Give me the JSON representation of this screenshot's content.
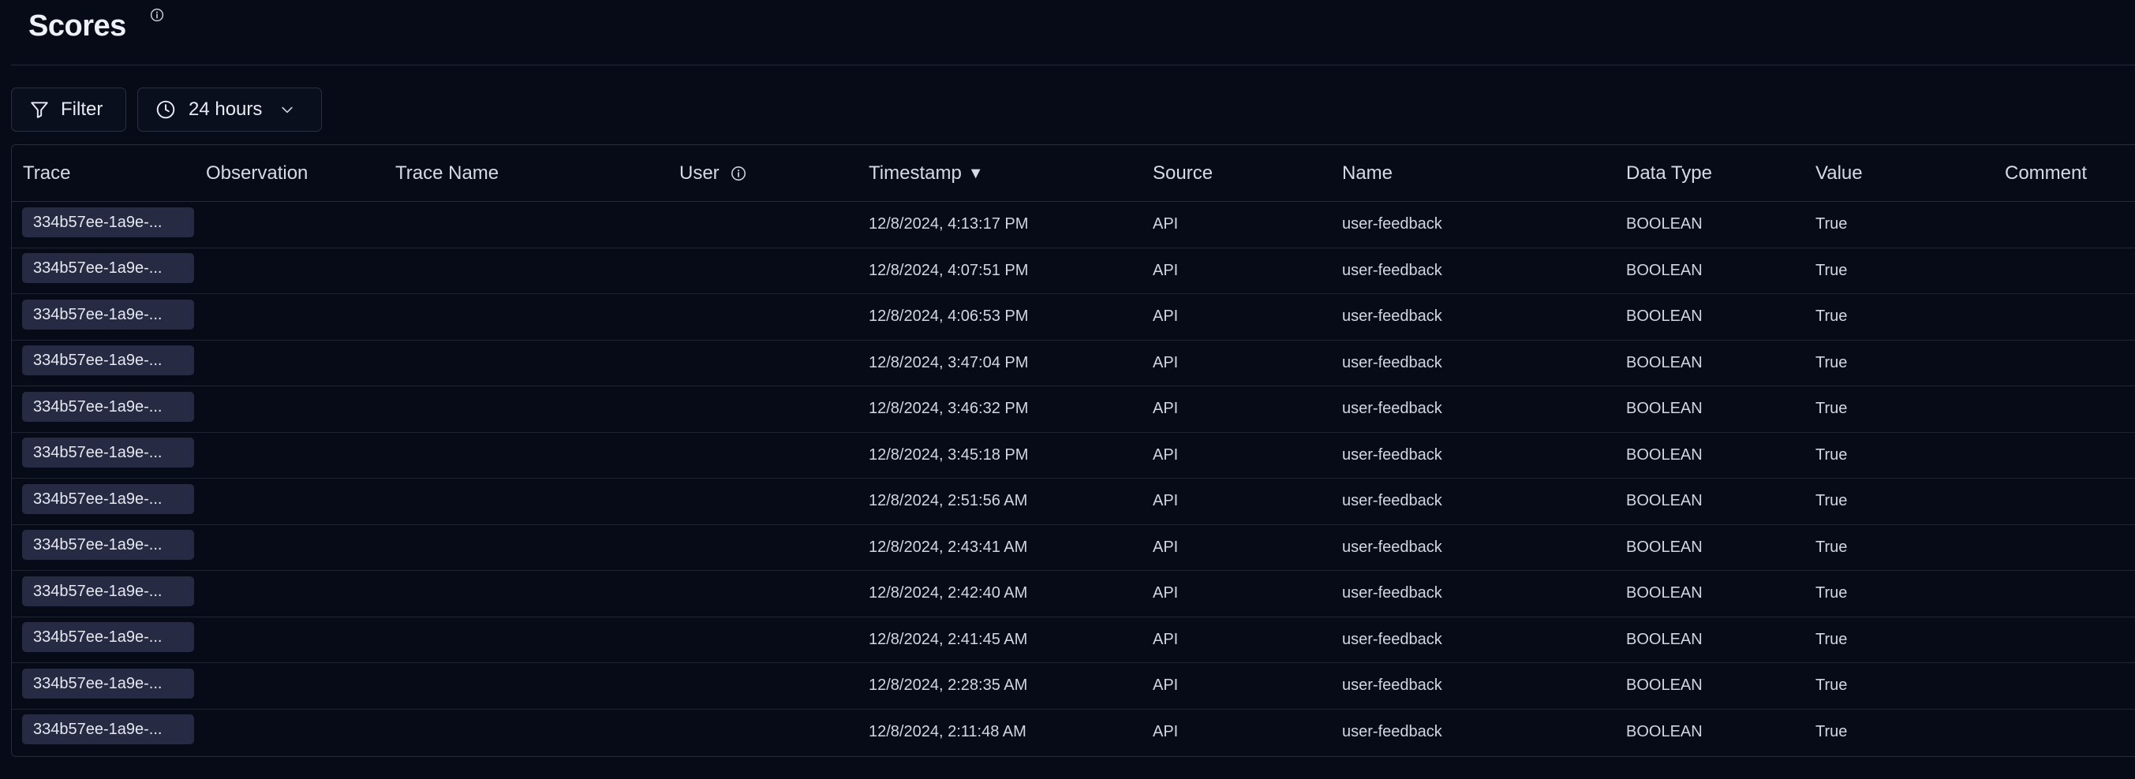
{
  "header": {
    "title": "Scores"
  },
  "toolbar": {
    "filter_label": "Filter",
    "time_range_label": "24 hours"
  },
  "table": {
    "columns": {
      "trace": "Trace",
      "observation": "Observation",
      "trace_name": "Trace Name",
      "user": "User",
      "timestamp": "Timestamp",
      "timestamp_sort": "▼",
      "source": "Source",
      "name": "Name",
      "data_type": "Data Type",
      "value": "Value",
      "comment": "Comment"
    },
    "rows": [
      {
        "trace": "334b57ee-1a9e-...",
        "observation": "",
        "trace_name": "",
        "user": "",
        "timestamp": "12/8/2024, 4:13:17 PM",
        "source": "API",
        "name": "user-feedback",
        "data_type": "BOOLEAN",
        "value": "True",
        "comment": ""
      },
      {
        "trace": "334b57ee-1a9e-...",
        "observation": "",
        "trace_name": "",
        "user": "",
        "timestamp": "12/8/2024, 4:07:51 PM",
        "source": "API",
        "name": "user-feedback",
        "data_type": "BOOLEAN",
        "value": "True",
        "comment": ""
      },
      {
        "trace": "334b57ee-1a9e-...",
        "observation": "",
        "trace_name": "",
        "user": "",
        "timestamp": "12/8/2024, 4:06:53 PM",
        "source": "API",
        "name": "user-feedback",
        "data_type": "BOOLEAN",
        "value": "True",
        "comment": ""
      },
      {
        "trace": "334b57ee-1a9e-...",
        "observation": "",
        "trace_name": "",
        "user": "",
        "timestamp": "12/8/2024, 3:47:04 PM",
        "source": "API",
        "name": "user-feedback",
        "data_type": "BOOLEAN",
        "value": "True",
        "comment": ""
      },
      {
        "trace": "334b57ee-1a9e-...",
        "observation": "",
        "trace_name": "",
        "user": "",
        "timestamp": "12/8/2024, 3:46:32 PM",
        "source": "API",
        "name": "user-feedback",
        "data_type": "BOOLEAN",
        "value": "True",
        "comment": ""
      },
      {
        "trace": "334b57ee-1a9e-...",
        "observation": "",
        "trace_name": "",
        "user": "",
        "timestamp": "12/8/2024, 3:45:18 PM",
        "source": "API",
        "name": "user-feedback",
        "data_type": "BOOLEAN",
        "value": "True",
        "comment": ""
      },
      {
        "trace": "334b57ee-1a9e-...",
        "observation": "",
        "trace_name": "",
        "user": "",
        "timestamp": "12/8/2024, 2:51:56 AM",
        "source": "API",
        "name": "user-feedback",
        "data_type": "BOOLEAN",
        "value": "True",
        "comment": ""
      },
      {
        "trace": "334b57ee-1a9e-...",
        "observation": "",
        "trace_name": "",
        "user": "",
        "timestamp": "12/8/2024, 2:43:41 AM",
        "source": "API",
        "name": "user-feedback",
        "data_type": "BOOLEAN",
        "value": "True",
        "comment": ""
      },
      {
        "trace": "334b57ee-1a9e-...",
        "observation": "",
        "trace_name": "",
        "user": "",
        "timestamp": "12/8/2024, 2:42:40 AM",
        "source": "API",
        "name": "user-feedback",
        "data_type": "BOOLEAN",
        "value": "True",
        "comment": ""
      },
      {
        "trace": "334b57ee-1a9e-...",
        "observation": "",
        "trace_name": "",
        "user": "",
        "timestamp": "12/8/2024, 2:41:45 AM",
        "source": "API",
        "name": "user-feedback",
        "data_type": "BOOLEAN",
        "value": "True",
        "comment": ""
      },
      {
        "trace": "334b57ee-1a9e-...",
        "observation": "",
        "trace_name": "",
        "user": "",
        "timestamp": "12/8/2024, 2:28:35 AM",
        "source": "API",
        "name": "user-feedback",
        "data_type": "BOOLEAN",
        "value": "True",
        "comment": ""
      },
      {
        "trace": "334b57ee-1a9e-...",
        "observation": "",
        "trace_name": "",
        "user": "",
        "timestamp": "12/8/2024, 2:11:48 AM",
        "source": "API",
        "name": "user-feedback",
        "data_type": "BOOLEAN",
        "value": "True",
        "comment": ""
      }
    ]
  },
  "icons": {
    "title_info": "info-icon",
    "filter": "filter-icon",
    "clock": "clock-icon",
    "chevron": "chevron-down-icon",
    "user_info": "info-icon"
  }
}
